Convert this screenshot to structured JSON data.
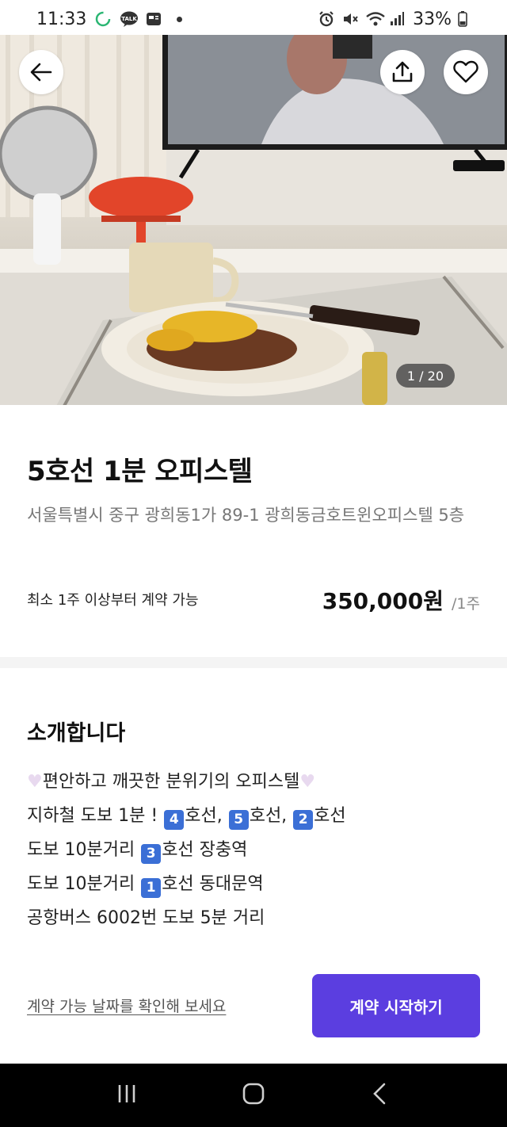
{
  "status_bar": {
    "time": "11:33",
    "battery": "33%",
    "left_icons": [
      "sync-icon",
      "kakaotalk-icon",
      "news-icon"
    ],
    "right_icons": [
      "alarm-icon",
      "mute-icon",
      "wifi-icon",
      "signal-icon",
      "battery-icon"
    ]
  },
  "hero": {
    "page_indicator": "1 / 20"
  },
  "listing": {
    "title": "5호선 1분 오피스텔",
    "address": "서울특별시 중구 광희동1가 89-1 광희동금호트윈오피스텔 5층",
    "min_contract": "최소 1주 이상부터 계약 가능",
    "price": "350,000원",
    "price_unit": "/1주"
  },
  "intro": {
    "title": "소개합니다",
    "line1_text": "편안하고 깨끗한 분위기의 오피스텔",
    "line2_a": "지하철 도보 1분 ! ",
    "line2_b1": "4",
    "line2_b": "호선, ",
    "line2_c1": "5",
    "line2_c": "호선, ",
    "line2_d1": "2",
    "line2_d": "호선",
    "line3_a": "도보 10분거리 ",
    "line3_n": "3",
    "line3_b": "호선 장충역",
    "line4_a": "도보 10분거리 ",
    "line4_n": "1",
    "line4_b": "호선 동대문역",
    "line5": "공항버스 6002번 도보 5분 거리"
  },
  "footer": {
    "date_link": "계약 가능 날짜를 확인해 보세요",
    "cta": "계약 시작하기"
  },
  "colors": {
    "accent": "#5b3ee0",
    "number_badge": "#3b6fd6"
  }
}
